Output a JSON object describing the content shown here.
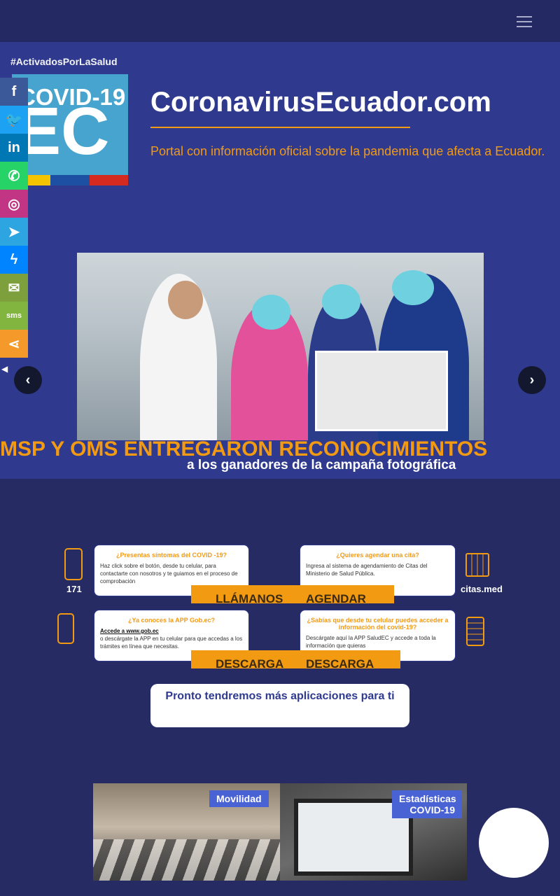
{
  "header": {
    "menu_icon": "hamburger-menu-icon"
  },
  "hero": {
    "hashtag": "#ActivadosPorLaSalud",
    "logo_line1": "COVID-19",
    "logo_line2": "EC",
    "site_title": "CoronavirusEcuador.com",
    "description": "Portal con información oficial sobre la pandemia que afecta a Ecuador.",
    "colors": {
      "orange": "#f29a12",
      "blue": "#2f3a8f",
      "navy": "#262b63"
    }
  },
  "share": {
    "items": [
      {
        "label": "f",
        "icon": "facebook-icon",
        "color": "#3b5998"
      },
      {
        "label": "🐦",
        "icon": "twitter-icon",
        "color": "#1da1f2"
      },
      {
        "label": "in",
        "icon": "linkedin-icon",
        "color": "#0077b5"
      },
      {
        "label": "✆",
        "icon": "whatsapp-icon",
        "color": "#25d366"
      },
      {
        "label": "◎",
        "icon": "instagram-icon",
        "color": "#c13584"
      },
      {
        "label": "➤",
        "icon": "telegram-icon",
        "color": "#2ca5e0"
      },
      {
        "label": "ϟ",
        "icon": "messenger-icon",
        "color": "#0084ff"
      },
      {
        "label": "✉",
        "icon": "email-icon",
        "color": "#7d9f3c"
      },
      {
        "label": "sms",
        "icon": "sms-icon",
        "color": "#82b440"
      },
      {
        "label": "⋖",
        "icon": "share-icon",
        "color": "#f59a2a"
      }
    ],
    "hide_icon": "chevron-left-icon"
  },
  "slider": {
    "caption_main": "MSP Y OMS ENTREGARON RECONOCIMIENTOS",
    "caption_sub": "a los ganadores de la campaña fotográfica",
    "prev_icon": "chevron-left-icon",
    "next_icon": "chevron-right-icon"
  },
  "services": {
    "card1": {
      "title": "¿Presentas síntomas del COVID -19?",
      "body": "Haz click sobre el botón, desde tu celular, para contactarte con nosotros y te guiamos en el proceso de comprobación"
    },
    "card2": {
      "title": "¿Quieres agendar una cita?",
      "body": "Ingresa al sistema de agendamiento de Citas del Ministerio de Salud Pública."
    },
    "card3": {
      "title": "¿Ya conoces la APP Gob.ec?",
      "link": "Accede a www.gob.ec",
      "body": "o descárgate la APP en tu celular para que accedas a los trámites en línea que necesitas."
    },
    "card4": {
      "title": "¿Sabías que desde tu celular puedes acceder a información del covid-19?",
      "body": "Descárgate aquí la APP SaludEC y accede a toda la información que quieras"
    },
    "btn_call": "LLÁMANOS",
    "btn_schedule": "AGENDAR",
    "btn_download1": "DESCARGA",
    "btn_download2": "DESCARGA",
    "phone_number": "171",
    "citas_label": "citas.med"
  },
  "pronto": "Pronto tendremos más aplicaciones para ti",
  "tiles": {
    "movilidad": "Movilidad",
    "estadisticas": "Estadísticas COVID-19"
  }
}
